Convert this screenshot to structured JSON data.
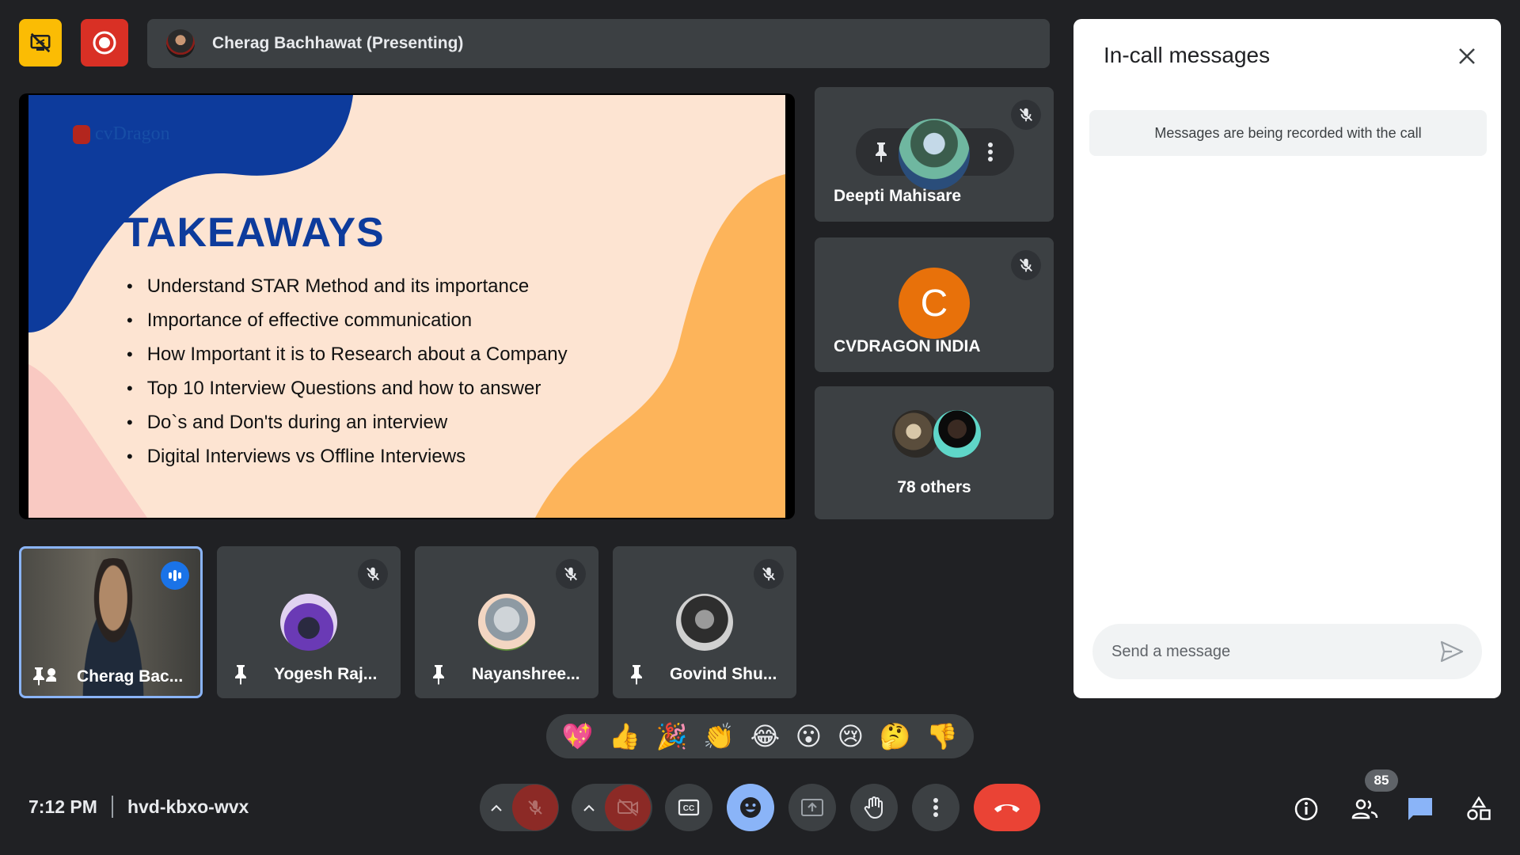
{
  "header": {
    "presenter_label": "Cherag Bachhawat (Presenting)",
    "icons": [
      "stop-presenting-icon",
      "recording-icon"
    ]
  },
  "slide": {
    "brand": "cvDragon",
    "title": "TAKEAWAYS",
    "bullets": [
      "Understand STAR Method and its importance",
      "Importance of effective communication",
      "How Important it is to Research about a Company",
      "Top 10 Interview Questions and how to answer",
      "Do`s and Don'ts during an interview",
      "Digital Interviews vs Offline Interviews"
    ],
    "colors": {
      "background": "#fde4d2",
      "blue": "#0d3b9c",
      "orange": "#fdb45a",
      "pink": "#f9c9c2"
    }
  },
  "side_tiles": [
    {
      "name": "Deepti Mahisare",
      "muted": true,
      "hover_controls": [
        "pin-icon",
        "more-options-icon"
      ]
    },
    {
      "name": "CVDRAGON INDIA",
      "muted": true,
      "avatar_letter": "C",
      "avatar_color": "#e8710a"
    },
    {
      "name": "78 others"
    }
  ],
  "bottom_tiles": [
    {
      "name": "Cherag Bac...",
      "speaking": true,
      "active_border": "#8ab4f8"
    },
    {
      "name": "Yogesh Raj...",
      "muted": true
    },
    {
      "name": "Nayanshree...",
      "muted": true
    },
    {
      "name": "Govind Shu...",
      "muted": true
    }
  ],
  "chat": {
    "title": "In-call messages",
    "notice": "Messages are being recorded with the call",
    "placeholder": "Send a message"
  },
  "reactions": [
    "💖",
    "👍",
    "🎉",
    "👏",
    "😂",
    "😮",
    "😢",
    "🤔",
    "👎"
  ],
  "footer": {
    "time": "7:12 PM",
    "meeting_code": "hvd-kbxo-wvx",
    "participant_count": "85",
    "controls": [
      "mic-off",
      "camera-off",
      "captions",
      "emoji",
      "present",
      "raise-hand",
      "more-options",
      "leave-call"
    ],
    "right_controls": [
      "meeting-details",
      "people",
      "chat",
      "activities"
    ]
  }
}
